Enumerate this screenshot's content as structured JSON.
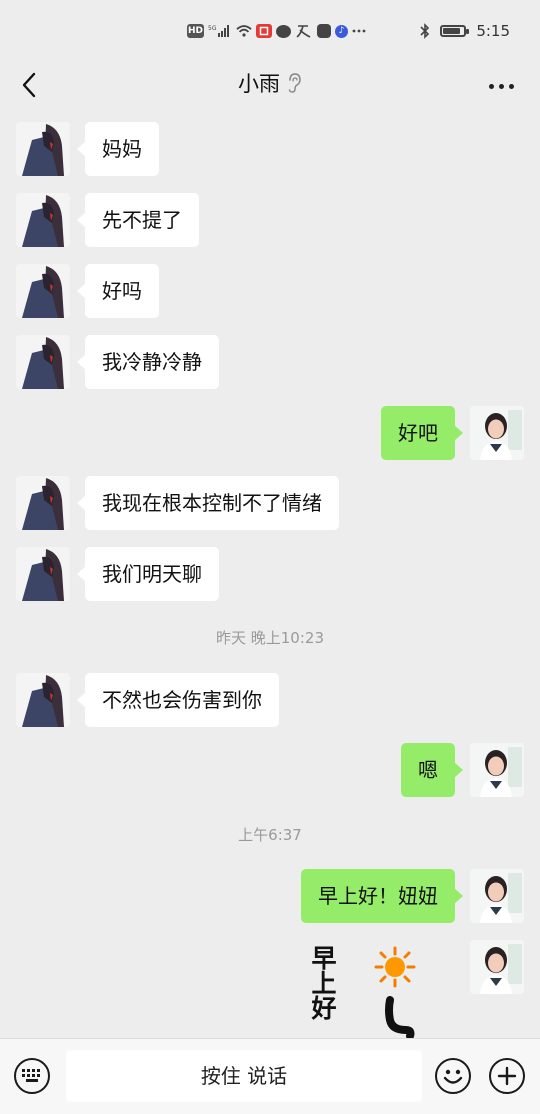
{
  "status_bar": {
    "hd": "HD",
    "signal": "5G",
    "time": "5:15",
    "battery_level": 0.85
  },
  "header": {
    "title": "小雨"
  },
  "messages": [
    {
      "side": "in",
      "text": "妈妈"
    },
    {
      "side": "in",
      "text": "先不提了"
    },
    {
      "side": "in",
      "text": "好吗"
    },
    {
      "side": "in",
      "text": "我冷静冷静"
    },
    {
      "side": "out",
      "text": "好吧"
    },
    {
      "side": "in",
      "text": "我现在根本控制不了情绪"
    },
    {
      "side": "in",
      "text": "我们明天聊"
    },
    {
      "side": "time",
      "text": "昨天 晚上10:23"
    },
    {
      "side": "in",
      "text": "不然也会伤害到你"
    },
    {
      "side": "out",
      "text": "嗯"
    },
    {
      "side": "time",
      "text": "上午6:37"
    },
    {
      "side": "out",
      "text": "早上好！妞妞"
    },
    {
      "side": "sticker",
      "text": "早上好"
    }
  ],
  "input_bar": {
    "hold_to_talk_label": "按住 说话"
  },
  "colors": {
    "background": "#ededed",
    "incoming_bubble": "#ffffff",
    "outgoing_bubble": "#95ec69",
    "timestamp_text": "#9a9a9a"
  },
  "icons": {
    "back": "chevron-left-icon",
    "ear": "ear-icon",
    "more": "more-dots-icon",
    "keyboard": "keyboard-icon",
    "emoji": "smiley-icon",
    "plus": "plus-icon",
    "sticker_sun": "sun-icon"
  }
}
